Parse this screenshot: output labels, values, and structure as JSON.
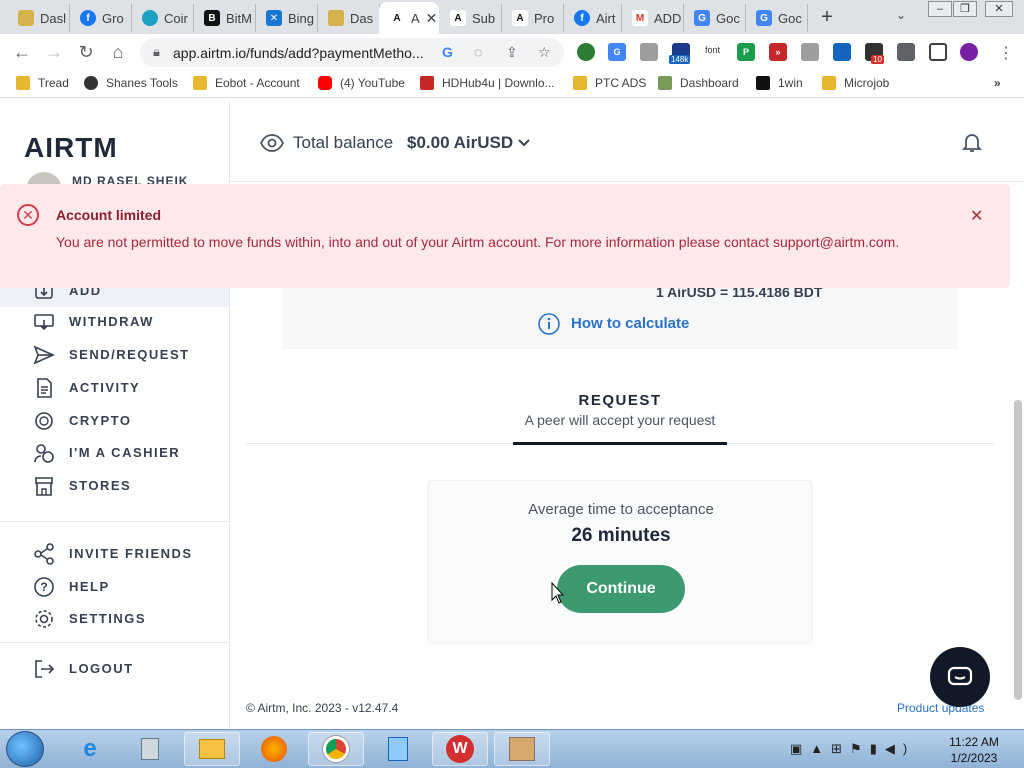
{
  "browser": {
    "tabs": [
      {
        "label": "Dasl",
        "color": "#d6b24a"
      },
      {
        "label": "Gro",
        "color": "#1877f2"
      },
      {
        "label": "Coir",
        "color": "#1da1c4"
      },
      {
        "label": "BitM",
        "color": "#111111"
      },
      {
        "label": "Bing",
        "color": "#1976d2"
      },
      {
        "label": "Das",
        "color": "#d6b24a"
      },
      {
        "label": "A",
        "color": "#111111"
      },
      {
        "label": "Sub",
        "color": "#111111"
      },
      {
        "label": "Pro",
        "color": "#111111"
      },
      {
        "label": "Airt",
        "color": "#1877f2"
      },
      {
        "label": "ADD",
        "color": "#d93025"
      },
      {
        "label": "Goc",
        "color": "#4285f4"
      },
      {
        "label": "Goc",
        "color": "#4285f4"
      }
    ],
    "url": "app.airtm.io/funds/add?paymentMetho...",
    "extension_badges": {
      "count": "148k",
      "font": "font",
      "notif": "10"
    },
    "bookmarks": [
      {
        "label": "Tread",
        "color": "#e8b730"
      },
      {
        "label": "Shanes Tools",
        "color": "#333333"
      },
      {
        "label": "Eobot - Account",
        "color": "#e8b730"
      },
      {
        "label": "(4) YouTube",
        "color": "#ff0000"
      },
      {
        "label": "HDHub4u | Downlo...",
        "color": "#c62828"
      },
      {
        "label": "PTC ADS",
        "color": "#e8b730"
      },
      {
        "label": "Dashboard",
        "color": "#7a9a5a"
      },
      {
        "label": "1win",
        "color": "#111111"
      },
      {
        "label": "Microjob",
        "color": "#e8b730"
      }
    ]
  },
  "app": {
    "logo": "AIRTM",
    "user_name": "MD RASEL SHEIK",
    "balance_label": "Total balance",
    "balance_value": "$0.00 AirUSD",
    "nav": [
      {
        "label": "ADD",
        "icon": "add-funds-icon"
      },
      {
        "label": "WITHDRAW",
        "icon": "withdraw-icon"
      },
      {
        "label": "SEND/REQUEST",
        "icon": "send-icon"
      },
      {
        "label": "ACTIVITY",
        "icon": "activity-icon"
      },
      {
        "label": "CRYPTO",
        "icon": "crypto-icon"
      },
      {
        "label": "I'M A CASHIER",
        "icon": "cashier-icon"
      },
      {
        "label": "STORES",
        "icon": "store-icon"
      },
      {
        "label": "INVITE FRIENDS",
        "icon": "share-icon"
      },
      {
        "label": "HELP",
        "icon": "help-icon"
      },
      {
        "label": "SETTINGS",
        "icon": "gear-icon"
      },
      {
        "label": "LOGOUT",
        "icon": "logout-icon"
      }
    ],
    "alert": {
      "title": "Account limited",
      "message": "You are not permitted to move funds within, into and out of your Airtm account. For more information please contact support@airtm.com."
    },
    "rate_text": "1 AirUSD = 115.4186 BDT",
    "how_to_calculate": "How to calculate",
    "request_tab": {
      "title": "REQUEST",
      "subtitle": "A peer will accept your request"
    },
    "card": {
      "label": "Average time to acceptance",
      "value": "26 minutes",
      "button": "Continue"
    },
    "footer": {
      "copyright": "© Airtm, Inc. 2023 - v12.47.4",
      "link": "Product updates"
    }
  },
  "taskbar": {
    "time": "11:22 AM",
    "date": "1/2/2023"
  },
  "colors": {
    "accent_green": "#3d9a6e",
    "alert_bg": "#fde8ea",
    "link_blue": "#2b72c4"
  }
}
